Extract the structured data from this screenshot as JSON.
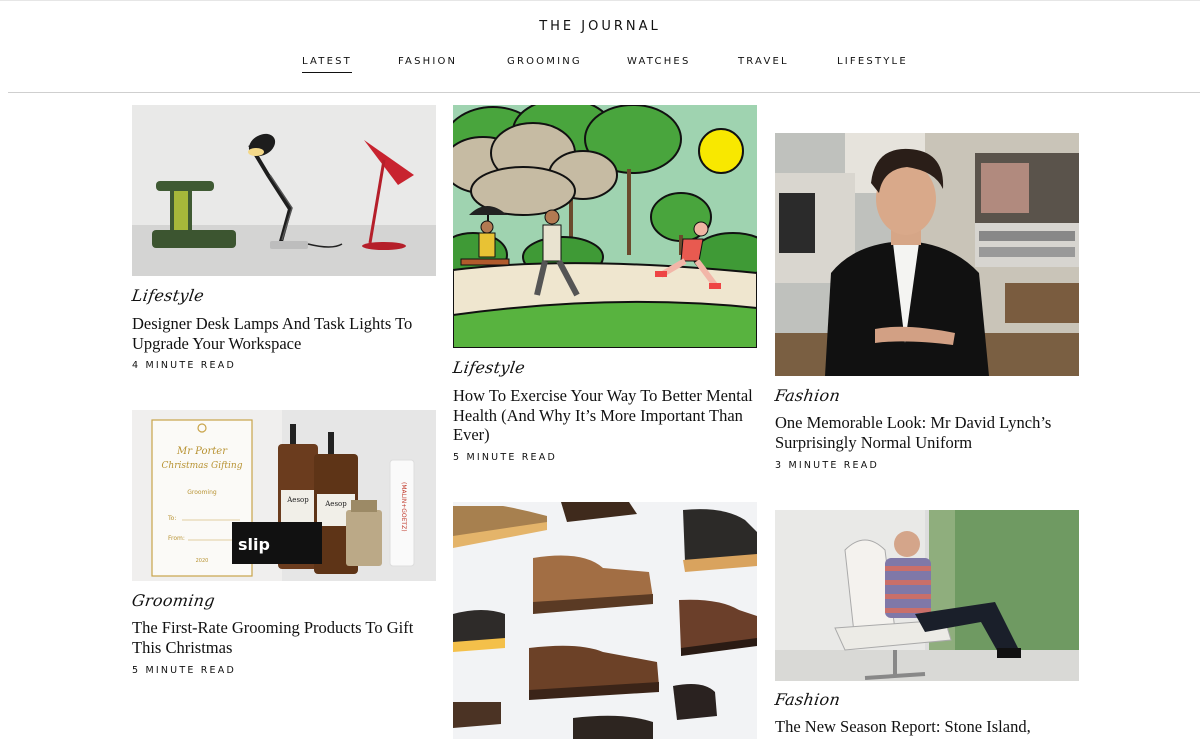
{
  "site": {
    "title": "THE JOURNAL"
  },
  "nav": {
    "items": [
      {
        "label": "LATEST",
        "active": true
      },
      {
        "label": "FASHION",
        "active": false
      },
      {
        "label": "GROOMING",
        "active": false
      },
      {
        "label": "WATCHES",
        "active": false
      },
      {
        "label": "TRAVEL",
        "active": false
      },
      {
        "label": "LIFESTYLE",
        "active": false
      }
    ]
  },
  "articles": [
    {
      "image": "desk-lamps-image",
      "category": "Lifestyle",
      "title": "Designer Desk Lamps And Task Lights To Upgrade Your Workspace",
      "read_time": "4 MINUTE READ"
    },
    {
      "image": "grooming-products-image",
      "category": "Grooming",
      "title": "The First-Rate Grooming Products To Gift This Christmas",
      "read_time": "5 MINUTE READ"
    },
    {
      "image": "exercise-illustration-image",
      "category": "Lifestyle",
      "title": "How To Exercise Your Way To Better Mental Health (And Why It’s More Important Than Ever)",
      "read_time": "5 MINUTE READ"
    },
    {
      "image": "suede-boots-image"
    },
    {
      "image": "david-lynch-portrait-image",
      "category": "Fashion",
      "title": "One Memorable Look: Mr David Lynch’s Surprisingly Normal Uniform",
      "read_time": "3 MINUTE READ"
    },
    {
      "image": "stone-island-image",
      "category": "Fashion",
      "title": "The New Season Report: Stone Island,"
    }
  ],
  "image_text": {
    "tag_line1": "Mr Porter",
    "tag_line2": "Christmas Gifting",
    "tag_grooming": "Grooming",
    "tag_to": "To:",
    "tag_from": "From:",
    "tag_year": "2020",
    "brand_aesop": "Aesop",
    "brand_slip": "slip",
    "brand_malin": "(MALIN+GOETZ)"
  }
}
